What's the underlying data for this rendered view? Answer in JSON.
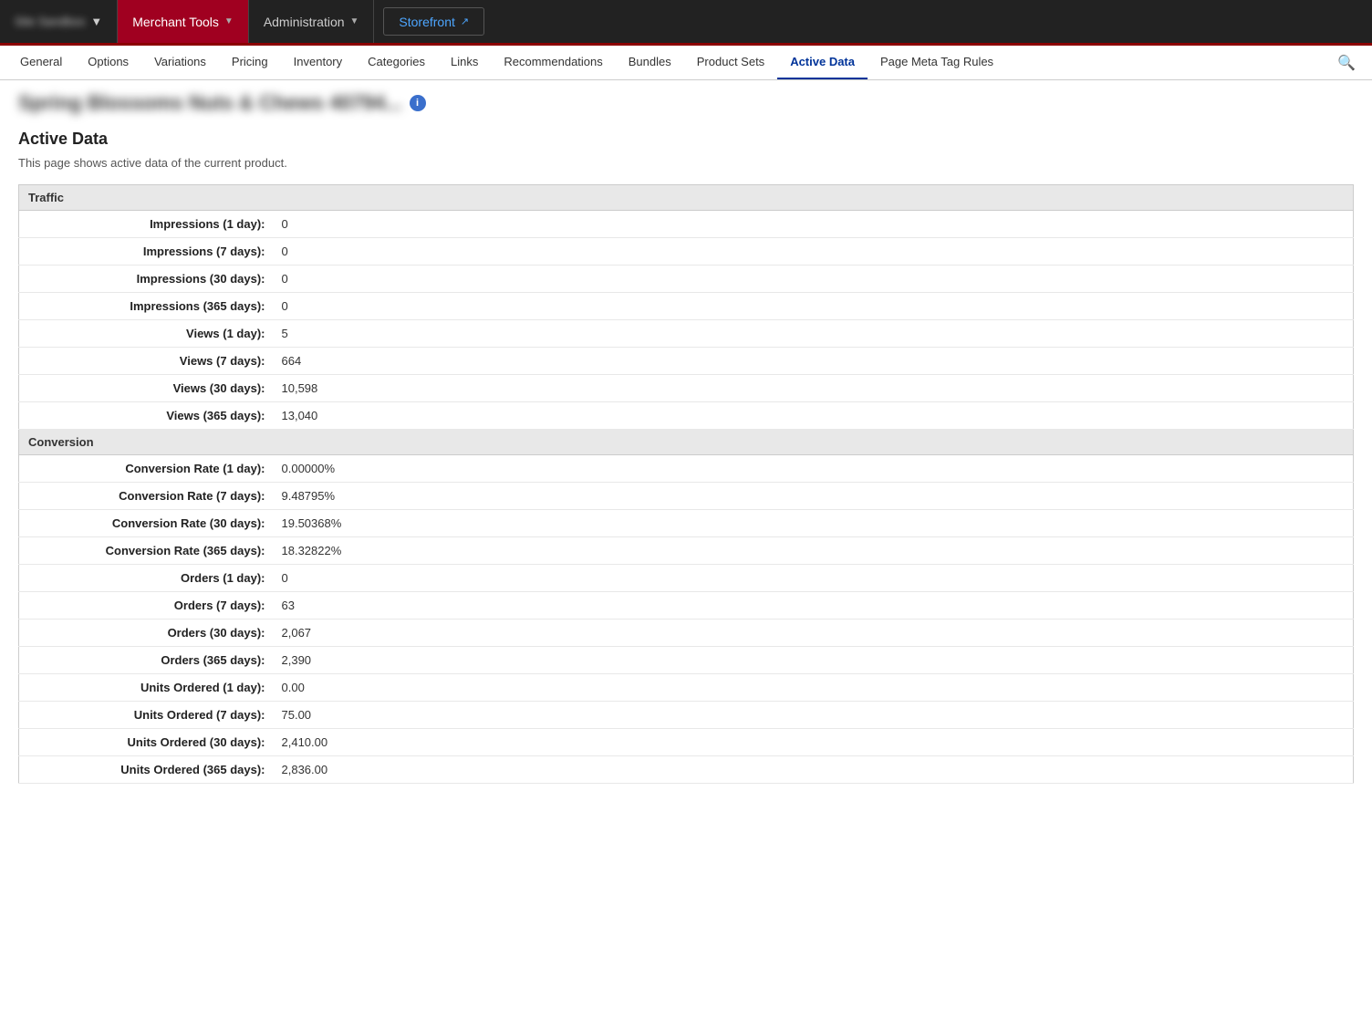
{
  "topNav": {
    "siteSelector": {
      "label": "Site Selector",
      "blurredText": "Site Sandbox"
    },
    "merchantTools": {
      "label": "Merchant Tools"
    },
    "administration": {
      "label": "Administration"
    },
    "storefront": {
      "label": "Storefront",
      "extIcon": "↗"
    }
  },
  "tabs": [
    {
      "id": "general",
      "label": "General"
    },
    {
      "id": "options",
      "label": "Options"
    },
    {
      "id": "variations",
      "label": "Variations"
    },
    {
      "id": "pricing",
      "label": "Pricing"
    },
    {
      "id": "inventory",
      "label": "Inventory"
    },
    {
      "id": "categories",
      "label": "Categories"
    },
    {
      "id": "links",
      "label": "Links"
    },
    {
      "id": "recommendations",
      "label": "Recommendations"
    },
    {
      "id": "bundles",
      "label": "Bundles"
    },
    {
      "id": "product-sets",
      "label": "Product Sets"
    },
    {
      "id": "active-data",
      "label": "Active Data",
      "active": true
    },
    {
      "id": "page-meta-tag-rules",
      "label": "Page Meta Tag Rules"
    }
  ],
  "productTitle": "Spring Blossoms Nuts & Chews 40794...",
  "infoIcon": "i",
  "page": {
    "heading": "Active Data",
    "description": "This page shows active data of the current product."
  },
  "trafficGroup": {
    "label": "Traffic",
    "rows": [
      {
        "label": "Impressions (1 day):",
        "value": "0"
      },
      {
        "label": "Impressions (7 days):",
        "value": "0"
      },
      {
        "label": "Impressions (30 days):",
        "value": "0"
      },
      {
        "label": "Impressions (365 days):",
        "value": "0"
      },
      {
        "label": "Views (1 day):",
        "value": "5"
      },
      {
        "label": "Views (7 days):",
        "value": "664"
      },
      {
        "label": "Views (30 days):",
        "value": "10,598"
      },
      {
        "label": "Views (365 days):",
        "value": "13,040"
      }
    ]
  },
  "conversionGroup": {
    "label": "Conversion",
    "rows": [
      {
        "label": "Conversion Rate (1 day):",
        "value": "0.00000%"
      },
      {
        "label": "Conversion Rate (7 days):",
        "value": "9.48795%"
      },
      {
        "label": "Conversion Rate (30 days):",
        "value": "19.50368%"
      },
      {
        "label": "Conversion Rate (365 days):",
        "value": "18.32822%"
      },
      {
        "label": "Orders (1 day):",
        "value": "0"
      },
      {
        "label": "Orders (7 days):",
        "value": "63"
      },
      {
        "label": "Orders (30 days):",
        "value": "2,067"
      },
      {
        "label": "Orders (365 days):",
        "value": "2,390"
      },
      {
        "label": "Units Ordered (1 day):",
        "value": "0.00"
      },
      {
        "label": "Units Ordered (7 days):",
        "value": "75.00"
      },
      {
        "label": "Units Ordered (30 days):",
        "value": "2,410.00"
      },
      {
        "label": "Units Ordered (365 days):",
        "value": "2,836.00"
      }
    ]
  }
}
